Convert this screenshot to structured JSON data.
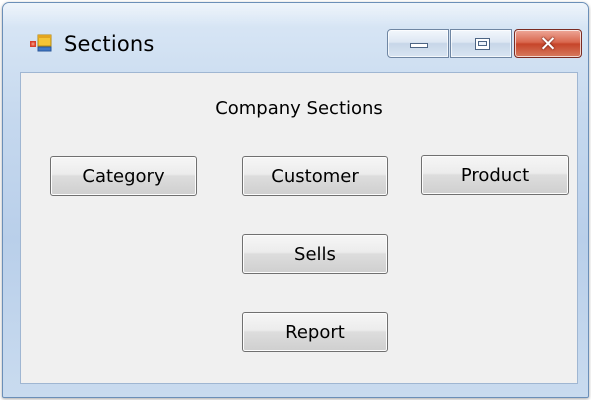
{
  "window": {
    "title": "Sections",
    "icon": "form-icon",
    "controls": {
      "minimize_icon": "minimize-icon",
      "maximize_icon": "maximize-icon",
      "close_glyph": "✕"
    }
  },
  "form": {
    "heading": "Company Sections",
    "buttons": {
      "category": "Category",
      "customer": "Customer",
      "product": "Product",
      "sells": "Sells",
      "report": "Report"
    }
  },
  "colors": {
    "frame": "#c5d8ee",
    "client_background": "#f0f0f0",
    "close_button": "#c6452a"
  }
}
